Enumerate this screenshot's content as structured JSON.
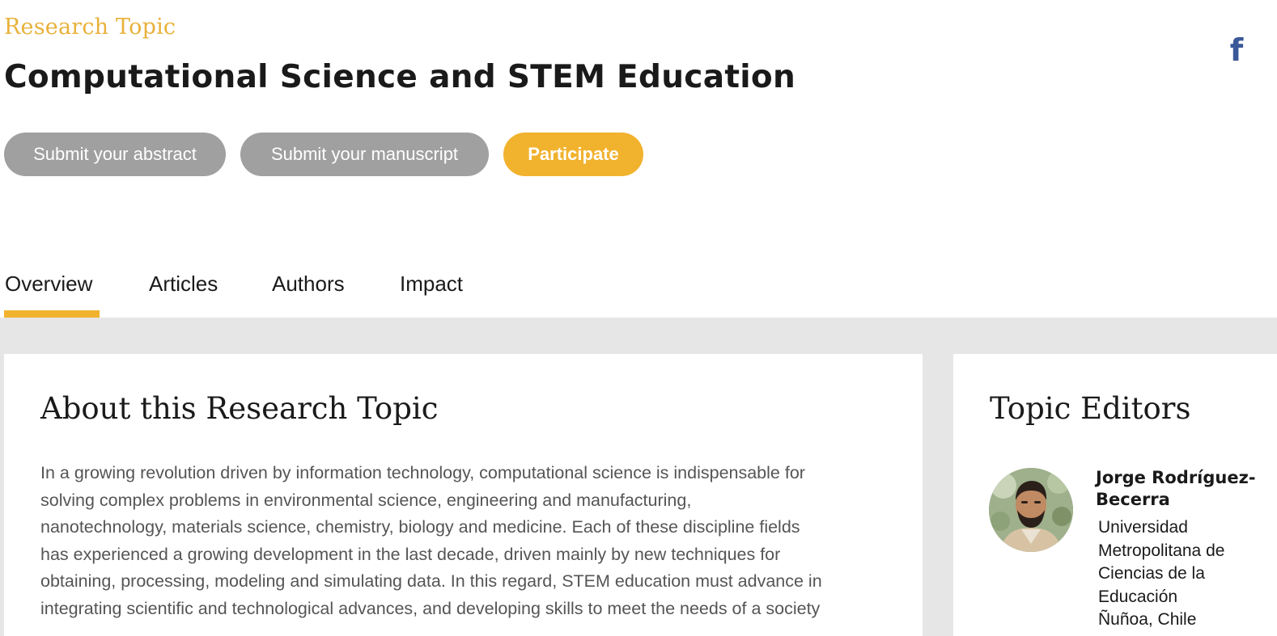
{
  "header": {
    "eyebrow": "Research Topic",
    "title": "Computational Science and STEM Education",
    "social_icon": "facebook-icon",
    "social_glyph": "f"
  },
  "actions": {
    "abstract_label": "Submit your abstract",
    "manuscript_label": "Submit your manuscript",
    "participate_label": "Participate"
  },
  "tabs": [
    {
      "label": "Overview",
      "active": true
    },
    {
      "label": "Articles",
      "active": false
    },
    {
      "label": "Authors",
      "active": false
    },
    {
      "label": "Impact",
      "active": false
    }
  ],
  "about": {
    "title": "About this Research Topic",
    "lines": [
      "In a growing revolution driven by information technology, computational science is indispensable for",
      "solving complex problems in environmental science, engineering and manufacturing,",
      "nanotechnology, materials science, chemistry, biology and medicine. Each of these discipline fields",
      "has experienced a growing development in the last decade, driven mainly by new techniques for",
      "obtaining, processing, modeling and simulating data. In this regard, STEM education must advance in",
      "integrating scientific and technological advances, and developing skills to meet the needs of a society"
    ]
  },
  "editors": {
    "title": "Topic Editors",
    "items": [
      {
        "name_line1": "Jorge Rodríguez-",
        "name_line2": "Becerra",
        "affiliation": [
          "Universidad",
          "Metropolitana de",
          "Ciencias de la",
          "Educación",
          "Ñuñoa, Chile"
        ]
      }
    ]
  },
  "colors": {
    "accent": "#f1b22e",
    "eyebrow": "#e8b13a",
    "button_gray": "#a0a0a0",
    "facebook": "#3b5998",
    "page_bg": "#e6e6e6"
  }
}
